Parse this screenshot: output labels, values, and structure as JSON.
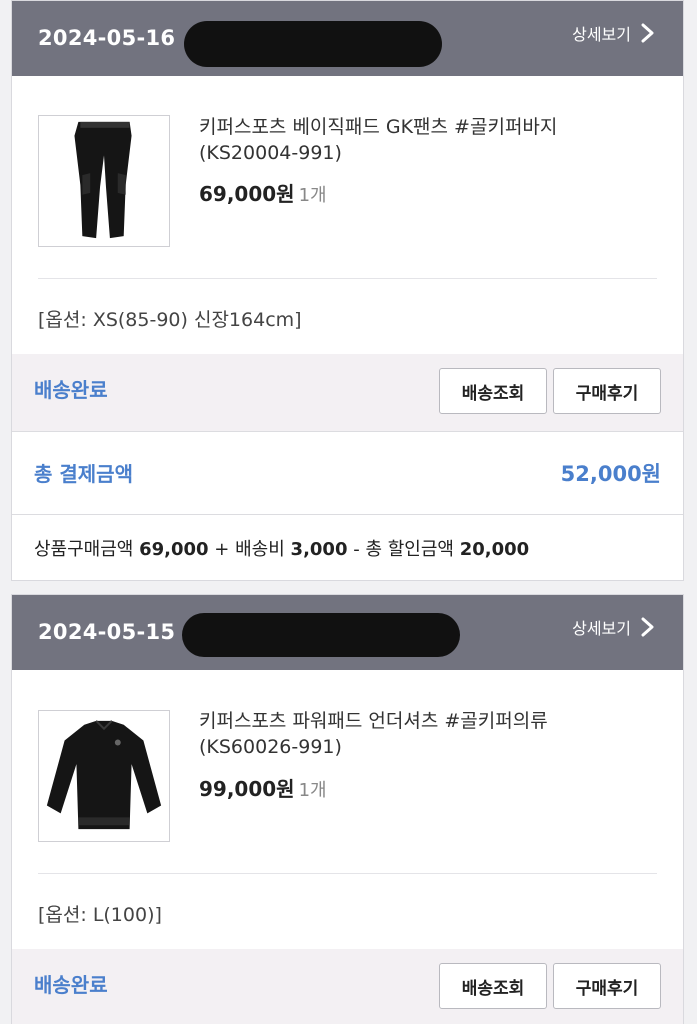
{
  "orders": [
    {
      "date": "2024-05-16",
      "detail_label": "상세보기",
      "product_name": "키퍼스포츠 베이직패드 GK팬츠 #골키퍼바지 (KS20004-991)",
      "price": "69,000원",
      "qty": "1개",
      "option": "[옵션: XS(85-90) 신장164cm]",
      "status": "배송완료",
      "track_label": "배송조회",
      "review_label": "구매후기",
      "total_label": "총 결제금액",
      "total_value": "52,000원",
      "breakdown": {
        "item_label": "상품구매금액",
        "item_value": "69,000",
        "plus": "+",
        "ship_label": "배송비",
        "ship_value": "3,000",
        "minus": "-",
        "discount_label": "총 할인금액",
        "discount_value": "20,000"
      }
    },
    {
      "date": "2024-05-15",
      "detail_label": "상세보기",
      "product_name": "키퍼스포츠 파워패드 언더셔츠 #골키퍼의류 (KS60026-991)",
      "price": "99,000원",
      "qty": "1개",
      "option": "[옵션: L(100)]",
      "status": "배송완료",
      "track_label": "배송조회",
      "review_label": "구매후기"
    }
  ],
  "icons": {
    "detail": "chevron-right-icon"
  },
  "colors": {
    "header_bg": "#72737f",
    "accent_blue": "#4a7fcc",
    "status_bg": "#f3f0f3"
  }
}
